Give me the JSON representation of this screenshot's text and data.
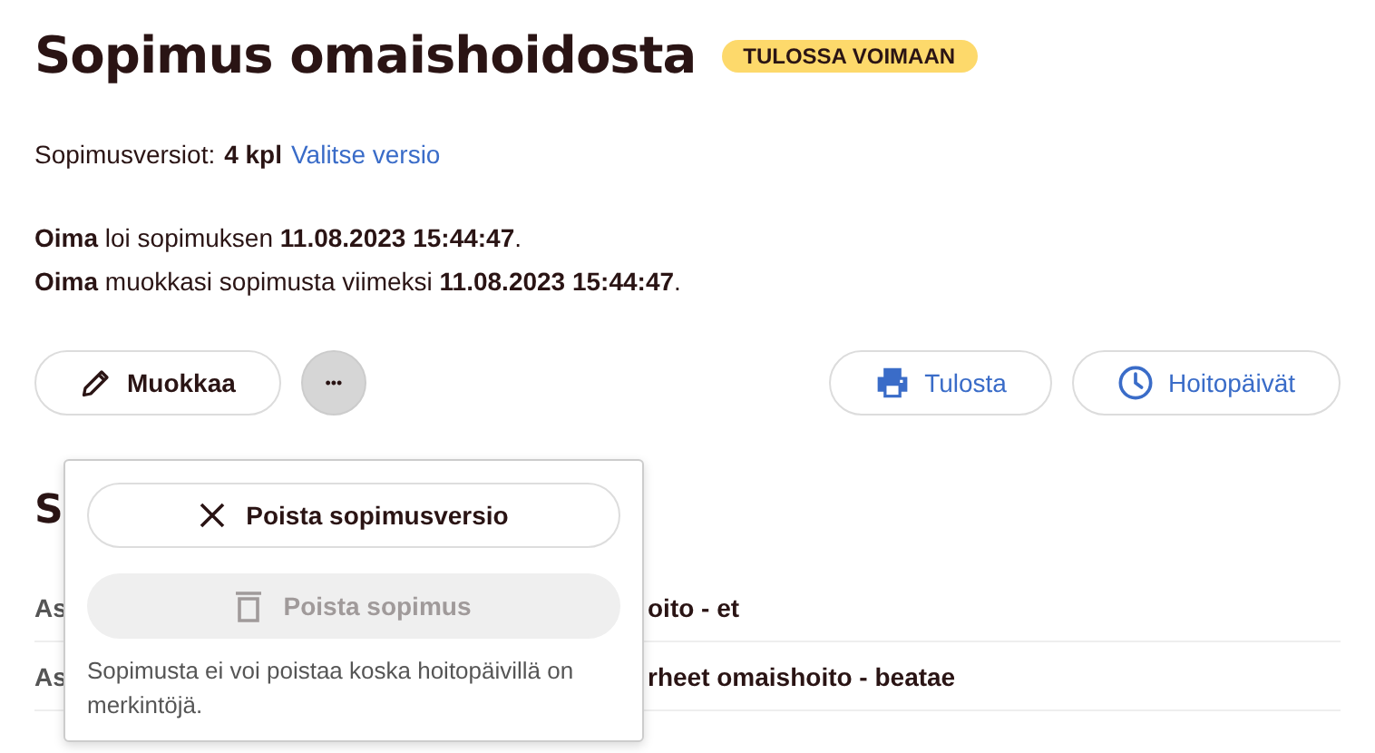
{
  "title": "Sopimus omaishoidosta",
  "status_badge": "TULOSSA VOIMAAN",
  "versions": {
    "label": "Sopimusversiot:",
    "count": "4 kpl",
    "link": "Valitse versio"
  },
  "history": [
    "**Oima** loi sopimuksen **11.08.2023 15:44:47**.",
    "**Oima** muokkasi sopimusta viimeksi **11.08.2023 15:44:47**."
  ],
  "actions": {
    "edit": "Muokkaa",
    "more": "•••",
    "print": "Tulosta",
    "care_days": "Hoitopäivät"
  },
  "menu": {
    "open": true,
    "items": [
      {
        "label": "Poista sopimusversio",
        "kind": "close",
        "disabled": false
      },
      {
        "label": "Poista sopimus",
        "kind": "trash",
        "disabled": true
      }
    ],
    "note": "Sopimusta ei voi poistaa koska hoitopäivillä on merkintöjä."
  },
  "section_heading": "S",
  "rows": [
    {
      "label": "As",
      "value": "oito - et"
    },
    {
      "label": "As",
      "value": "rheet omaishoito - beatae"
    }
  ]
}
